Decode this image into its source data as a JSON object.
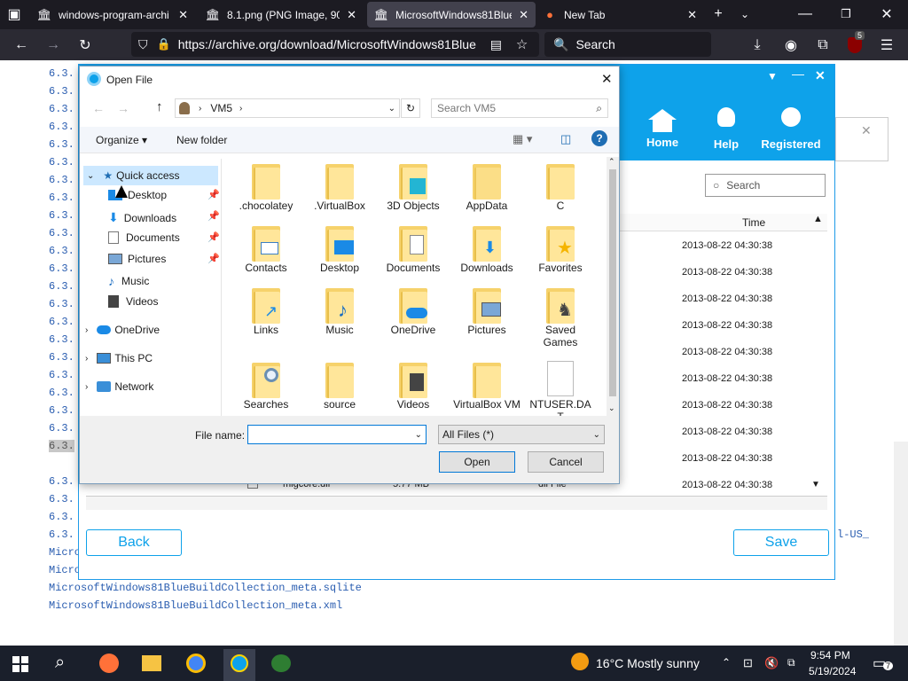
{
  "browser": {
    "tabs": [
      {
        "label": "windows-program-archi",
        "icon": "archive-icon"
      },
      {
        "label": "8.1.png (PNG Image, 900",
        "icon": "archive-icon"
      },
      {
        "label": "MicrosoftWindows81Blue",
        "icon": "archive-icon"
      },
      {
        "label": "New Tab",
        "icon": "firefox-icon"
      }
    ],
    "url": "https://archive.org/download/MicrosoftWindows81Blue",
    "search_placeholder": "Search",
    "ext_badge": "5"
  },
  "page": {
    "code_prefix": "6.3.",
    "lines": [
      "Microsoft",
      "Microsoft",
      "MicrosoftWindows81BlueBuildCollection_meta.sqlite",
      "MicrosoftWindows81BlueBuildCollection_meta.xml"
    ],
    "right_snippet": "l-US_"
  },
  "app": {
    "header_buttons": [
      {
        "label": "Home",
        "icon": "home-icon"
      },
      {
        "label": "Help",
        "icon": "bulb-icon"
      },
      {
        "label": "Registered",
        "icon": "user-badge-icon"
      }
    ],
    "search_placeholder": "Search",
    "time_header": "Time",
    "times": [
      "2013-08-22 04:30:38",
      "2013-08-22 04:30:38",
      "2013-08-22 04:30:38",
      "2013-08-22 04:30:38",
      "2013-08-22 04:30:38",
      "2013-08-22 04:30:38",
      "2013-08-22 04:30:38",
      "2013-08-22 04:30:38",
      "2013-08-22 04:30:38",
      "2013-08-22 04:30:38"
    ],
    "last_row": {
      "name": "migcore.dll",
      "size": "5.77 MB",
      "type": "dll File"
    },
    "back_label": "Back",
    "save_label": "Save"
  },
  "dialog": {
    "title": "Open File",
    "breadcrumb": "VM5",
    "search_placeholder": "Search VM5",
    "organize_label": "Organize",
    "new_folder_label": "New folder",
    "nav": [
      {
        "label": "Quick access",
        "icon": "star-icon"
      },
      {
        "label": "Desktop",
        "icon": "desktop-icon"
      },
      {
        "label": "Downloads",
        "icon": "download-icon"
      },
      {
        "label": "Documents",
        "icon": "document-icon"
      },
      {
        "label": "Pictures",
        "icon": "picture-icon"
      },
      {
        "label": "Music",
        "icon": "music-icon"
      },
      {
        "label": "Videos",
        "icon": "video-icon"
      },
      {
        "label": "OneDrive",
        "icon": "cloud-icon"
      },
      {
        "label": "This PC",
        "icon": "pc-icon"
      },
      {
        "label": "Network",
        "icon": "network-icon"
      }
    ],
    "items": [
      ".chocolatey",
      ".VirtualBox",
      "3D Objects",
      "AppData",
      "C",
      "Contacts",
      "Desktop",
      "Documents",
      "Downloads",
      "Favorites",
      "Links",
      "Music",
      "OneDrive",
      "Pictures",
      "Saved Games",
      "Searches",
      "source",
      "Videos",
      "VirtualBox VM",
      "NTUSER.DA T"
    ],
    "file_name_label": "File name:",
    "file_name_value": "",
    "filter_label": "All Files (*)",
    "open_label": "Open",
    "cancel_label": "Cancel"
  },
  "taskbar": {
    "weather": "16°C  Mostly sunny",
    "time": "9:54 PM",
    "date": "5/19/2024",
    "notif_count": "7"
  },
  "colors": {
    "app_blue": "#0ea2ea",
    "firefox_bar": "#1c1b22",
    "link_blue": "#2a5db0"
  }
}
